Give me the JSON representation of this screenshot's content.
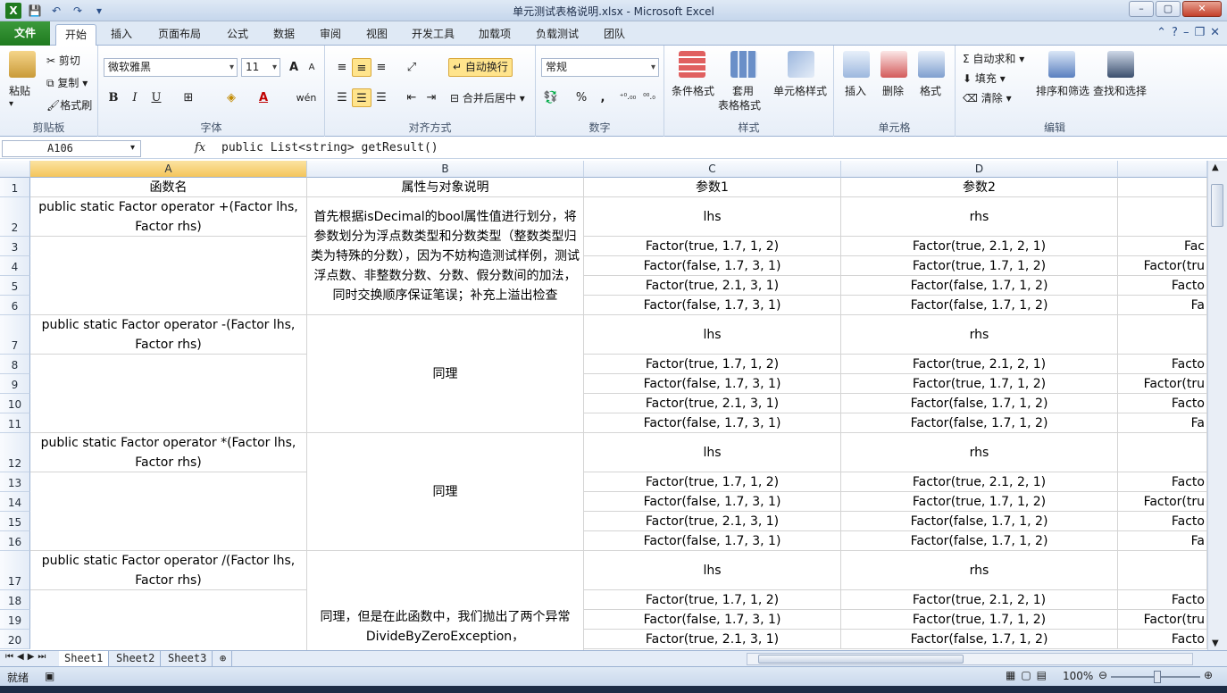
{
  "window": {
    "title": "单元测试表格说明.xlsx - Microsoft Excel",
    "min": "–",
    "max": "▢",
    "close": "✕"
  },
  "tabs": {
    "file": "文件",
    "items": [
      "开始",
      "插入",
      "页面布局",
      "公式",
      "数据",
      "审阅",
      "视图",
      "开发工具",
      "加载项",
      "负载测试",
      "团队"
    ]
  },
  "ribbon": {
    "clipboard": {
      "paste": "粘贴",
      "cut": "剪切",
      "copy": "复制",
      "format_painter": "格式刷",
      "label": "剪贴板"
    },
    "font": {
      "name": "微软雅黑",
      "size": "11",
      "label": "字体",
      "bold": "B",
      "italic": "I",
      "underline": "U",
      "grow": "A",
      "shrink": "A",
      "wen": "wén"
    },
    "alignment": {
      "wrap": "自动换行",
      "merge": "合并后居中",
      "label": "对齐方式"
    },
    "number": {
      "format": "常规",
      "label": "数字",
      "percent": "%",
      "comma": ",",
      "inc": "⁺⁰.₀₀",
      "dec": "⁰⁰.₀"
    },
    "styles": {
      "cond": "条件格式",
      "table1": "套用",
      "table2": "表格格式",
      "cell": "单元格样式",
      "label": "样式"
    },
    "cells": {
      "insert": "插入",
      "delete": "删除",
      "format": "格式",
      "label": "单元格"
    },
    "editing": {
      "autosum": "自动求和",
      "fill": "填充",
      "clear": "清除",
      "sort": "排序和筛选",
      "find": "查找和选择",
      "label": "编辑"
    },
    "sigma": "Σ"
  },
  "formula_bar": {
    "name": "A106",
    "fx": "fx",
    "formula": "public List<string> getResult()"
  },
  "columns": [
    "A",
    "B",
    "C",
    "D"
  ],
  "rows": [
    "1",
    "2",
    "3",
    "4",
    "5",
    "6",
    "7",
    "8",
    "9",
    "10",
    "11",
    "12",
    "13",
    "14",
    "15",
    "16",
    "17",
    "18",
    "19",
    "20"
  ],
  "cells": {
    "A1": "函数名",
    "B1": "属性与对象说明",
    "C1": "参数1",
    "D1": "参数2",
    "A2": "public static Factor operator +(Factor lhs, Factor rhs)",
    "A7": "public static Factor operator -(Factor lhs, Factor rhs)",
    "A12": "public static Factor operator *(Factor lhs, Factor rhs)",
    "A17": "public static Factor operator /(Factor lhs, Factor rhs)",
    "B2": "首先根据isDecimal的bool属性值进行划分，将参数划分为浮点数类型和分数类型（整数类型归类为特殊的分数），因为不妨构造测试样例，测试浮点数、非整数分数、分数、假分数间的加法，同时交换顺序保证笔误；补充上溢出检查",
    "B7": "同理",
    "B12": "同理",
    "B17": "同理，但是在此函数中，我们抛出了两个异常DivideByZeroException，",
    "C_lhs": "lhs",
    "D_rhs": "rhs",
    "C1v": "Factor(true, 1.7, 1, 2)",
    "C2v": "Factor(false, 1.7, 3, 1)",
    "C3v": "Factor(true, 2.1, 3, 1)",
    "C4v": "Factor(false, 1.7, 3, 1)",
    "D1v": "Factor(true, 2.1, 2, 1)",
    "D2v": "Factor(true, 1.7, 1, 2)",
    "D3v": "Factor(false, 1.7, 1, 2)",
    "D4v": "Factor(false, 1.7, 1, 2)",
    "E1": "Fac",
    "E2": "Factor(tru",
    "E3": "Facto",
    "E4": "Fa"
  },
  "sheets": [
    "Sheet1",
    "Sheet2",
    "Sheet3"
  ],
  "status": {
    "ready": "就绪",
    "zoom": "100%"
  }
}
